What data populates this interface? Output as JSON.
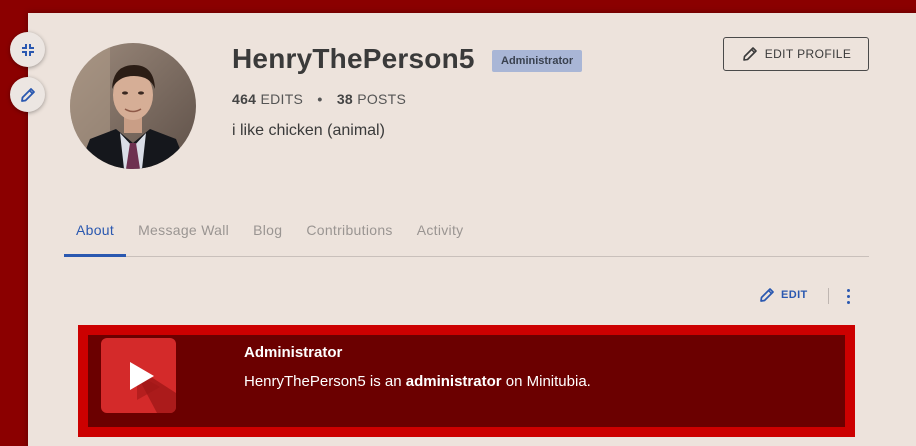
{
  "profile": {
    "username": "HenryThePerson5",
    "badge": "Administrator",
    "edits_count": "464",
    "edits_label": "EDITS",
    "stats_separator": "•",
    "posts_count": "38",
    "posts_label": "POSTS",
    "bio": "i like chicken (animal)",
    "edit_profile_label": "EDIT PROFILE"
  },
  "tabs": [
    {
      "label": "About",
      "active": true
    },
    {
      "label": "Message Wall",
      "active": false
    },
    {
      "label": "Blog",
      "active": false
    },
    {
      "label": "Contributions",
      "active": false
    },
    {
      "label": "Activity",
      "active": false
    }
  ],
  "content_toolbar": {
    "edit_label": "EDIT"
  },
  "infobox": {
    "title": "Administrator",
    "text_before": "HenryThePerson5 is an ",
    "text_bold": "administrator",
    "text_after": " on Minitubia."
  },
  "colors": {
    "outer_background": "#8b0000",
    "page_background": "#ede3dc",
    "accent": "#2a58b0",
    "badge_background": "#a9b6d6",
    "infobox_border": "#cc0000",
    "infobox_background": "#6b0000"
  },
  "icons": {
    "collapse": "collapse-arrows-icon",
    "pencil": "pencil-icon",
    "more": "more-vertical-icon",
    "play": "play-icon"
  }
}
